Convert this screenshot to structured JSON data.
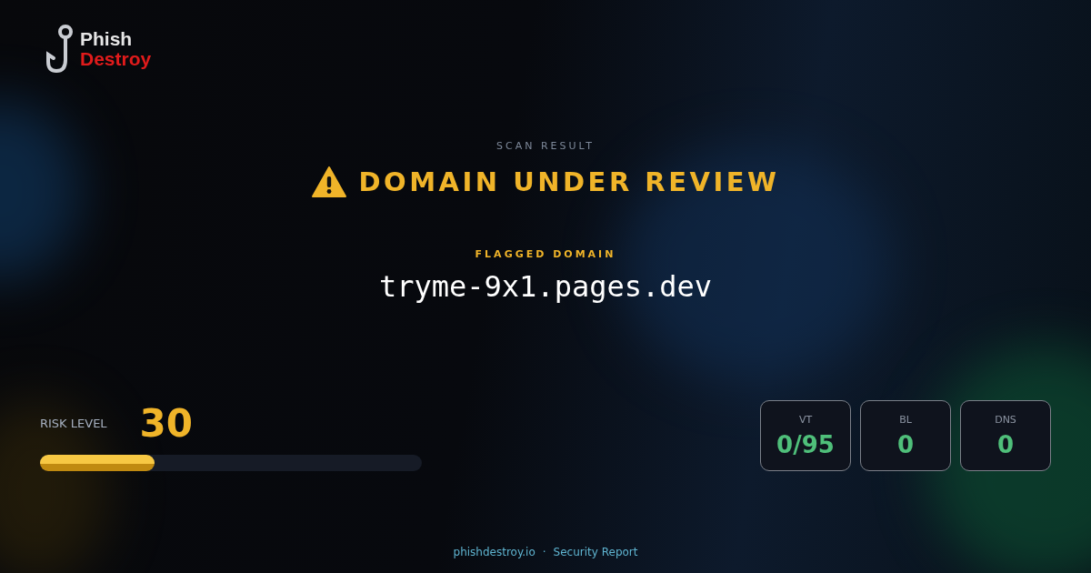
{
  "logo": {
    "line_1": "Phish",
    "line_2": "Destroy"
  },
  "eyebrow": "SCAN RESULT",
  "verdict": {
    "kind": "review",
    "label": "DOMAIN UNDER REVIEW"
  },
  "domain": {
    "label": "FLAGGED DOMAIN",
    "value": "tryme-9x1.pages.dev"
  },
  "risk": {
    "label": "RISK LEVEL",
    "score": "30",
    "level": 0.3
  },
  "stats": [
    {
      "label": "VT",
      "value": "0/95"
    },
    {
      "label": "BL",
      "value": "0"
    },
    {
      "label": "DNS",
      "value": "0"
    }
  ],
  "footer": {
    "site": "phishdestroy.io",
    "separator": "·",
    "label": "Security Report"
  }
}
